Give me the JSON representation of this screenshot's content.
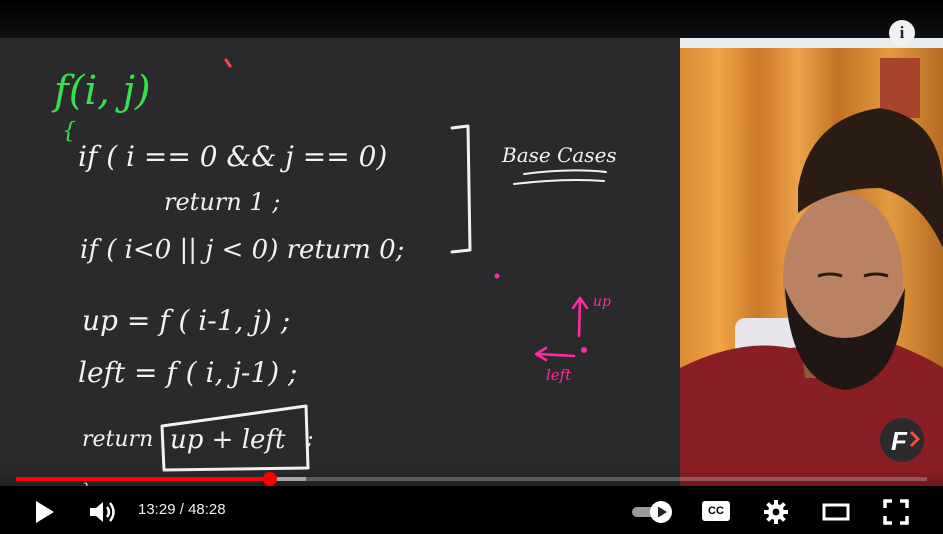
{
  "player": {
    "time": {
      "current": "13:29",
      "separator": " / ",
      "duration": "48:28"
    },
    "progress": {
      "played": 0.2784,
      "buffered": 0.3178
    },
    "controls": {
      "play": "play-icon",
      "volume": "volume-icon",
      "autoplay": "autoplay-toggle",
      "captions": "CC",
      "settings": "gear-icon",
      "theater": "theater-icon",
      "fullscreen": "fullscreen-icon"
    },
    "info_icon": "i",
    "channel_logo": "F"
  },
  "whiteboard": {
    "title": "f(i, j)",
    "lines": [
      "{",
      "if ( i == 0 && j == 0)",
      "return 1 ;",
      "if ( i<0 || j < 0) return 0;",
      "up = f ( i-1, j) ;",
      "left = f ( i, j-1) ;",
      "return",
      "up + left",
      ";",
      "}"
    ],
    "annotation": "Base Cases",
    "diagram": {
      "up_label": "up",
      "left_label": "left"
    }
  },
  "colors": {
    "board": "#2a2a2c",
    "chalk_green": "#35e04a",
    "chalk_white": "#f2f2f2",
    "chalk_pink": "#ff2aa6",
    "progress_red": "#ff0000"
  }
}
